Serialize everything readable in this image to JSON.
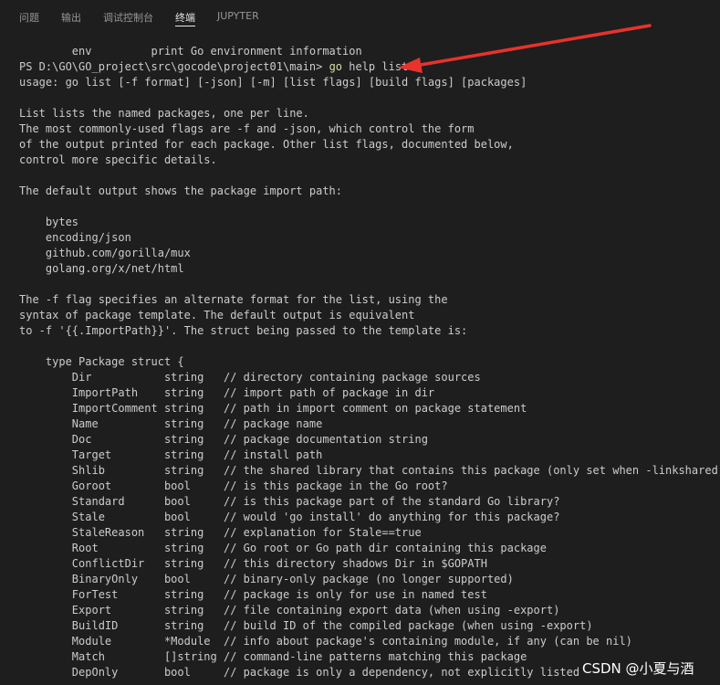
{
  "tabs": [
    {
      "label": "问题",
      "active": false
    },
    {
      "label": "输出",
      "active": false
    },
    {
      "label": "调试控制台",
      "active": false
    },
    {
      "label": "终端",
      "active": true
    },
    {
      "label": "JUPYTER",
      "active": false
    }
  ],
  "colors": {
    "background": "#1e1e1e",
    "text": "#cccccc",
    "command_highlight": "#dcdcaa",
    "arrow": "#e8322c"
  },
  "terminal": {
    "prompt": "PS D:\\GO\\GO_project\\src\\gocode\\project01\\main> ",
    "command_go": "go",
    "command_rest": " help list",
    "lines_before_prompt": [
      "        env         print Go environment information"
    ],
    "lines_after_prompt": [
      "usage: go list [-f format] [-json] [-m] [list flags] [build flags] [packages]",
      "",
      "List lists the named packages, one per line.",
      "The most commonly-used flags are -f and -json, which control the form",
      "of the output printed for each package. Other list flags, documented below,",
      "control more specific details.",
      "",
      "The default output shows the package import path:",
      "",
      "    bytes",
      "    encoding/json",
      "    github.com/gorilla/mux",
      "    golang.org/x/net/html",
      "",
      "The -f flag specifies an alternate format for the list, using the",
      "syntax of package template. The default output is equivalent",
      "to -f '{{.ImportPath}}'. The struct being passed to the template is:",
      "",
      "    type Package struct {",
      "        Dir           string   // directory containing package sources",
      "        ImportPath    string   // import path of package in dir",
      "        ImportComment string   // path in import comment on package statement",
      "        Name          string   // package name",
      "        Doc           string   // package documentation string",
      "        Target        string   // install path",
      "        Shlib         string   // the shared library that contains this package (only set when -linkshared)",
      "        Goroot        bool     // is this package in the Go root?",
      "        Standard      bool     // is this package part of the standard Go library?",
      "        Stale         bool     // would 'go install' do anything for this package?",
      "        StaleReason   string   // explanation for Stale==true",
      "        Root          string   // Go root or Go path dir containing this package",
      "        ConflictDir   string   // this directory shadows Dir in $GOPATH",
      "        BinaryOnly    bool     // binary-only package (no longer supported)",
      "        ForTest       string   // package is only for use in named test",
      "        Export        string   // file containing export data (when using -export)",
      "        BuildID       string   // build ID of the compiled package (when using -export)",
      "        Module        *Module  // info about package's containing module, if any (can be nil)",
      "        Match         []string // command-line patterns matching this package",
      "        DepOnly       bool     // package is only a dependency, not explicitly listed"
    ]
  },
  "watermark": "CSDN @小夏与酒"
}
